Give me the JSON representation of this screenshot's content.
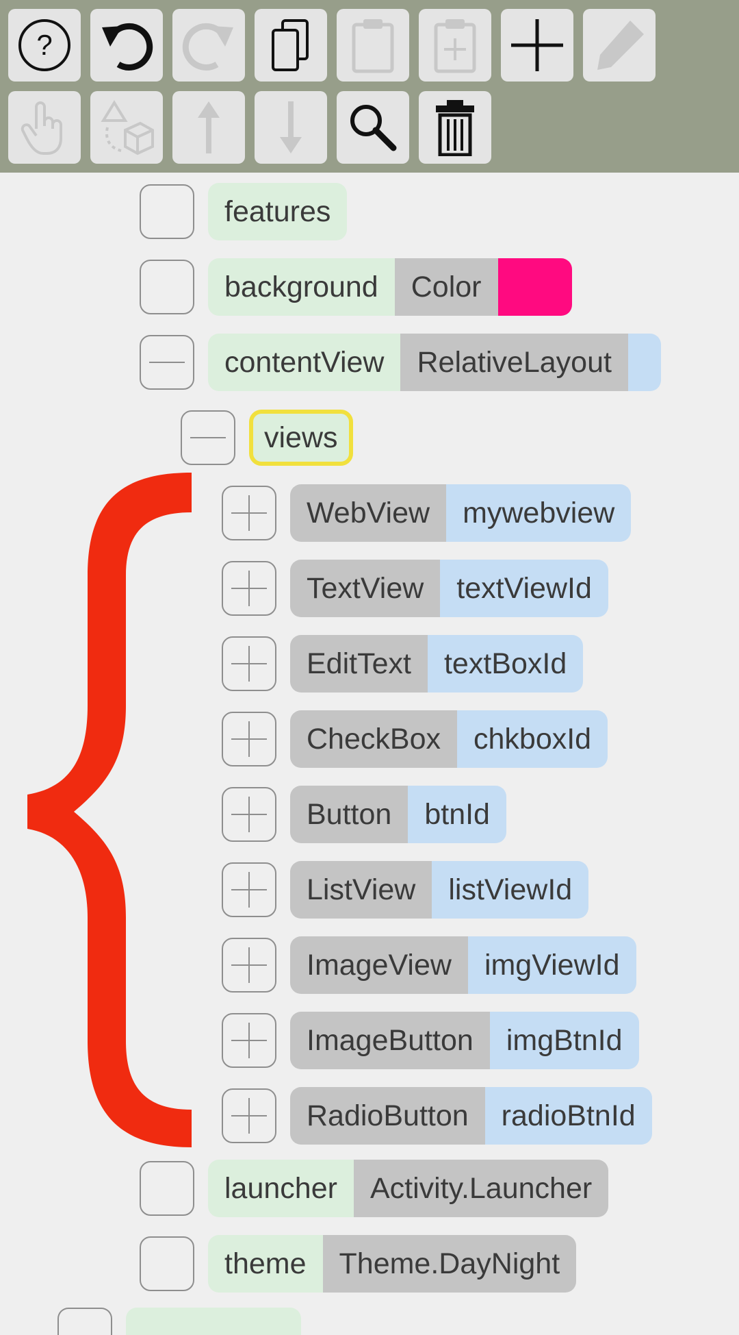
{
  "toolbar": {
    "buttons": [
      {
        "name": "help",
        "icon": "help-icon",
        "enabled": true
      },
      {
        "name": "undo",
        "icon": "undo-icon",
        "enabled": true
      },
      {
        "name": "redo",
        "icon": "redo-icon",
        "enabled": false
      },
      {
        "name": "copy",
        "icon": "copy-icon",
        "enabled": true
      },
      {
        "name": "paste",
        "icon": "paste-icon",
        "enabled": false
      },
      {
        "name": "paste-add",
        "icon": "paste-add-icon",
        "enabled": false
      },
      {
        "name": "add",
        "icon": "plus-icon",
        "enabled": true
      },
      {
        "name": "edit",
        "icon": "pencil-icon",
        "enabled": false
      },
      {
        "name": "select",
        "icon": "hand-pointer-icon",
        "enabled": false
      },
      {
        "name": "transform",
        "icon": "shapes-cube-icon",
        "enabled": false
      },
      {
        "name": "move-up",
        "icon": "arrow-up-icon",
        "enabled": false
      },
      {
        "name": "move-down",
        "icon": "arrow-down-icon",
        "enabled": false
      },
      {
        "name": "search",
        "icon": "search-icon",
        "enabled": true
      },
      {
        "name": "delete",
        "icon": "trash-icon",
        "enabled": true
      }
    ]
  },
  "tree": {
    "features": {
      "name": "features"
    },
    "background": {
      "name": "background",
      "type": "Color",
      "swatch_color": "#ff0a80"
    },
    "contentView": {
      "name": "contentView",
      "type": "RelativeLayout"
    },
    "views": {
      "name": "views"
    },
    "children": [
      {
        "type": "WebView",
        "id": "mywebview"
      },
      {
        "type": "TextView",
        "id": "textViewId"
      },
      {
        "type": "EditText",
        "id": "textBoxId"
      },
      {
        "type": "CheckBox",
        "id": "chkboxId"
      },
      {
        "type": "Button",
        "id": "btnId"
      },
      {
        "type": "ListView",
        "id": "listViewId"
      },
      {
        "type": "ImageView",
        "id": "imgViewId"
      },
      {
        "type": "ImageButton",
        "id": "imgBtnId"
      },
      {
        "type": "RadioButton",
        "id": "radioBtnId"
      }
    ],
    "launcher": {
      "name": "launcher",
      "type": "Activity.Launcher"
    },
    "theme": {
      "name": "theme",
      "type": "Theme.DayNight"
    }
  },
  "colors": {
    "toolbar_bg": "#979e8a",
    "name_segment": "#dcefdd",
    "type_segment": "#c4c4c4",
    "id_segment": "#c5ddf4",
    "selection_outline": "#f1e03d",
    "brace_annotation": "#f02b10"
  }
}
